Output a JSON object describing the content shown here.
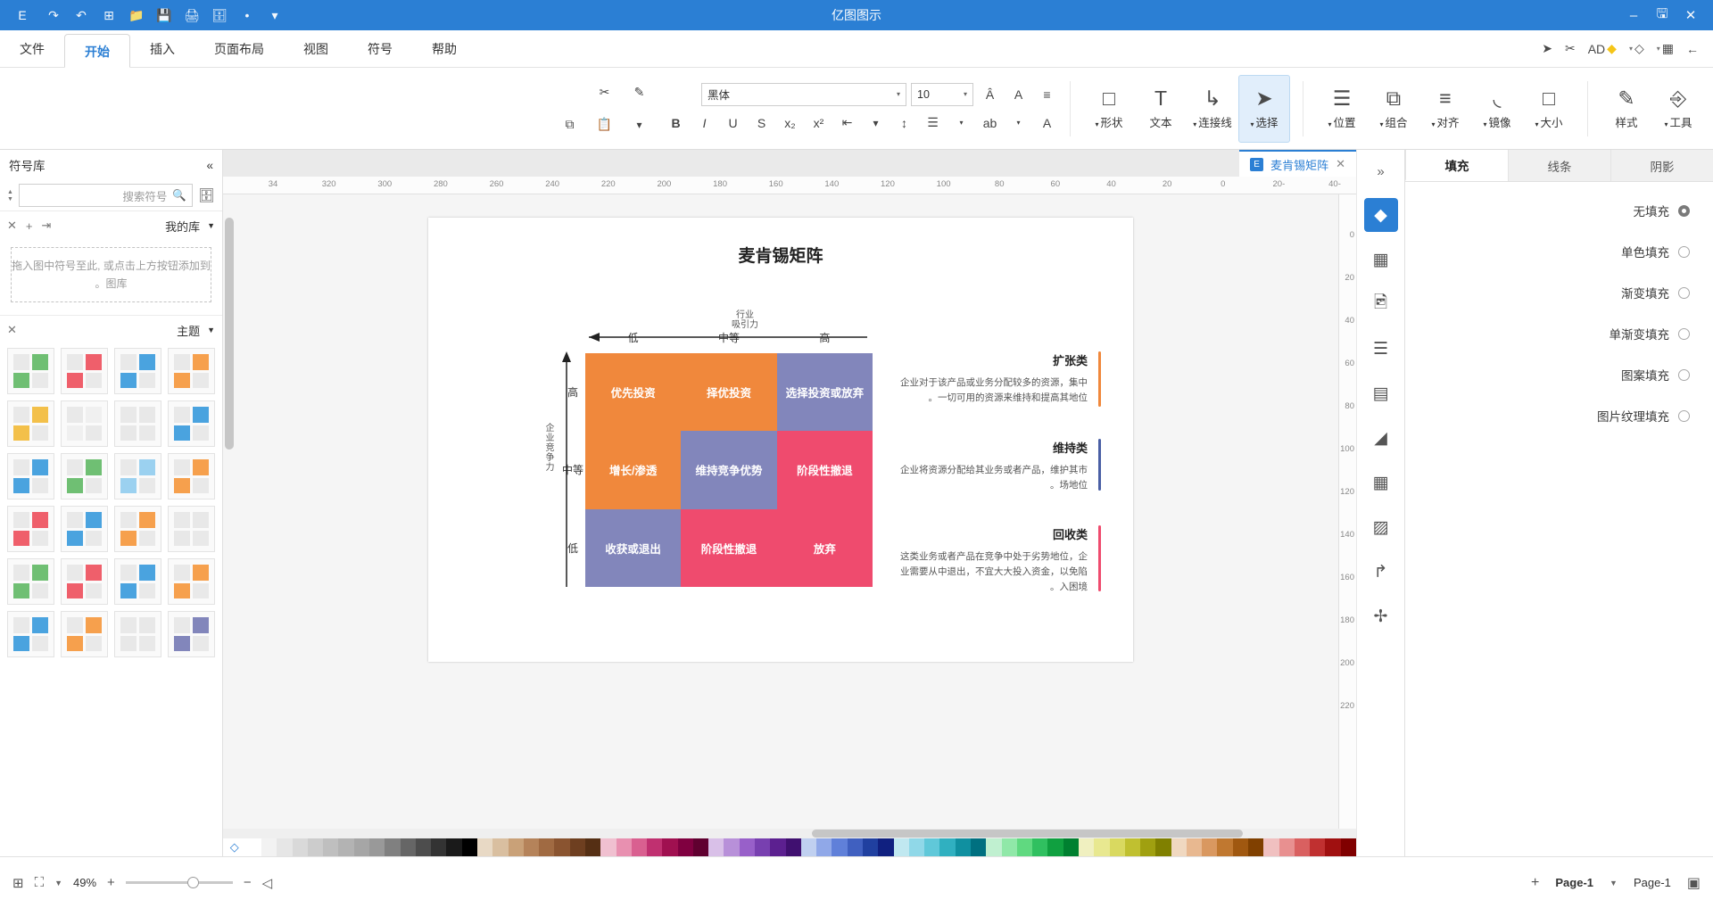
{
  "titlebar": {
    "title": "亿图图示",
    "left_icons": [
      "close-icon",
      "save-icon",
      "minimize-icon"
    ],
    "right_icons": [
      "chevron-down-icon",
      "grid-icon",
      "window-icon",
      "save-icon",
      "folder-icon",
      "new-icon",
      "undo-icon",
      "redo-icon"
    ],
    "app_badge": "E"
  },
  "quick_access": [
    {
      "name": "back",
      "glyph": "←"
    },
    {
      "name": "apps",
      "glyph": "∷",
      "caret": "▾"
    },
    {
      "name": "page-shape",
      "glyph": "⬜",
      "caret": "▾"
    },
    {
      "name": "highlight",
      "glyph": "◆",
      "label": "AD"
    },
    {
      "name": "scissors",
      "glyph": "✂"
    },
    {
      "name": "pointer",
      "glyph": "➤"
    }
  ],
  "ribbon_tabs": [
    {
      "label": "文件",
      "active": false
    },
    {
      "label": "开始",
      "active": true
    },
    {
      "label": "插入",
      "active": false
    },
    {
      "label": "页面布局",
      "active": false
    },
    {
      "label": "视图",
      "active": false
    },
    {
      "label": "符号",
      "active": false
    },
    {
      "label": "帮助",
      "active": false
    }
  ],
  "ribbon": {
    "font_name": "黑体",
    "font_size": "10",
    "buttons": [
      {
        "name": "tools",
        "label": "工具",
        "glyph": "⌨",
        "caret": true,
        "selected": false
      },
      {
        "name": "style",
        "label": "样式",
        "glyph": "✎",
        "caret": false,
        "selected": false
      },
      {
        "name": "size",
        "label": "大小",
        "glyph": "□",
        "caret": true,
        "selected": false
      },
      {
        "name": "mirror",
        "label": "镜像",
        "glyph": "◧",
        "caret": true,
        "selected": false
      },
      {
        "name": "align",
        "label": "对齐",
        "glyph": "≡",
        "caret": true,
        "selected": false
      },
      {
        "name": "combine",
        "label": "组合",
        "glyph": "⧉",
        "caret": true,
        "selected": false
      },
      {
        "name": "arrange",
        "label": "位置",
        "glyph": "☰",
        "caret": true,
        "selected": false
      },
      {
        "name": "select",
        "label": "选择",
        "glyph": "➤",
        "caret": true,
        "selected": true
      },
      {
        "name": "connector",
        "label": "连接线",
        "glyph": "⤴",
        "caret": true,
        "selected": false
      },
      {
        "name": "text",
        "label": "文本",
        "glyph": "T",
        "caret": false,
        "selected": false
      },
      {
        "name": "shape",
        "label": "形状",
        "glyph": "▭",
        "caret": true,
        "selected": false
      }
    ],
    "format_icons_row1": [
      "≡",
      "A",
      "Â"
    ],
    "format_icons_row2": [
      "A",
      "ab",
      "☰",
      "↕",
      "⤓",
      "x₂",
      "x²",
      "S",
      "U",
      "I",
      "B"
    ],
    "right_icons": [
      "✎",
      "✂",
      "⎘",
      "⧉"
    ]
  },
  "format_panel": {
    "tabs": [
      {
        "label": "填充",
        "active": true
      },
      {
        "label": "线条",
        "active": false
      },
      {
        "label": "阴影",
        "active": false
      }
    ],
    "options": [
      {
        "label": "无填充",
        "selected": true
      },
      {
        "label": "单色填充",
        "selected": false
      },
      {
        "label": "渐变填充",
        "selected": false
      },
      {
        "label": "单渐变填充",
        "selected": false
      },
      {
        "label": "图案填充",
        "selected": false
      },
      {
        "label": "图片纹理填充",
        "selected": false
      }
    ]
  },
  "left_rail": {
    "collapse_icon": "«",
    "items": [
      {
        "name": "fill-tool",
        "glyph": "◆",
        "active": true
      },
      {
        "name": "grid-tool",
        "glyph": "▦",
        "active": false
      },
      {
        "name": "image-tool",
        "glyph": "Ὓc",
        "active": false
      },
      {
        "name": "layers-tool",
        "glyph": "≣",
        "active": false
      },
      {
        "name": "container-tool",
        "glyph": "▤",
        "active": false
      },
      {
        "name": "chart-tool",
        "glyph": "◢",
        "active": false
      },
      {
        "name": "table-tool",
        "glyph": "⊞",
        "active": false
      },
      {
        "name": "crop-tool",
        "glyph": "⛶",
        "active": false
      },
      {
        "name": "flow-tool",
        "glyph": "↱",
        "active": false
      },
      {
        "name": "node-tool",
        "glyph": "⬚",
        "active": false
      }
    ]
  },
  "doc_tab": {
    "title": "麦肯锡矩阵",
    "close": "✕"
  },
  "rulers": {
    "h_ticks": [
      "-40",
      "-20",
      "0",
      "20",
      "40",
      "60",
      "80",
      "100",
      "120",
      "140",
      "160",
      "180",
      "200",
      "220",
      "240",
      "260",
      "280",
      "300",
      "320",
      "34"
    ],
    "v_ticks": [
      "0",
      "20",
      "40",
      "60",
      "80",
      "100",
      "120",
      "140",
      "160",
      "180",
      "200",
      "220"
    ]
  },
  "diagram": {
    "title": "麦肯锡矩阵",
    "x_axis_label": "行业\n吸引力",
    "y_axis_label": "企业竞争力",
    "col_headers": [
      "高",
      "中等",
      "低"
    ],
    "row_headers": [
      "高",
      "中等",
      "低"
    ],
    "cells": [
      {
        "text": "优先投资",
        "color": "#f0883c"
      },
      {
        "text": "择优投资",
        "color": "#f0883c"
      },
      {
        "text": "选择投资或放弃",
        "color": "#8286bb"
      },
      {
        "text": "增长/渗透",
        "color": "#f0883c"
      },
      {
        "text": "维持竞争优势",
        "color": "#8286bb"
      },
      {
        "text": "阶段性撤退",
        "color": "#ef4b6e"
      },
      {
        "text": "收获或退出",
        "color": "#8286bb"
      },
      {
        "text": "阶段性撤退",
        "color": "#ef4b6e"
      },
      {
        "text": "放弃",
        "color": "#ef4b6e"
      }
    ],
    "legend": [
      {
        "title": "扩张类",
        "color": "#f0883c",
        "desc": "企业对于该产品或业务分配较多的资源，集中一切可用的资源来维持和提高其地位。"
      },
      {
        "title": "维持类",
        "color": "#4a5fa5",
        "desc": "企业将资源分配给其业务或者产品，维护其市场地位。"
      },
      {
        "title": "回收类",
        "color": "#ef4b6e",
        "desc": "这类业务或者产品在竞争中处于劣势地位，企业需要从中退出，不宜大大投入资金，以免陷入困境。"
      }
    ]
  },
  "right_panel": {
    "header": "符号库",
    "header_icons": [
      "»",
      "⬛"
    ],
    "search_placeholder": "搜索符号",
    "sections": [
      {
        "title": "我的库",
        "icons": [
          "✕",
          "+",
          "⬚"
        ],
        "dropzone": "拖入图中符号至此, 或点击上方按钮添加到图库。"
      },
      {
        "title": "主题",
        "icons": [
          "✕"
        ]
      }
    ],
    "thumbs": [
      [
        "#f6a04d",
        "#4aa3df",
        "#ef5f6b",
        "#6fbf73"
      ],
      [
        "#4aa3df",
        "#e8e8e8",
        "#f0f0f0",
        "#f3c04a"
      ],
      [
        "#f6a04d",
        "#9bd1f0",
        "#6fbf73",
        "#4aa3df"
      ],
      [
        "#e8e8e8",
        "#f6a04d",
        "#4aa3df",
        "#ef5f6b"
      ],
      [
        "#f6a04d",
        "#4aa3df",
        "#ef5f6b",
        "#6fbf73"
      ],
      [
        "#8286bb",
        "#e8e8e8",
        "#f6a04d",
        "#4aa3df"
      ]
    ]
  },
  "status_bar": {
    "page_label": "Page-1",
    "page_tab": "Page-1",
    "add_page": "+",
    "dropdown": "▾",
    "zoom_percent": "49%",
    "zoom_out": "−",
    "zoom_in": "+",
    "icons": [
      "fit-page-icon",
      "fullscreen-icon",
      "presentation-icon",
      "layout-icon"
    ]
  },
  "palette_colors": [
    "#ffffff",
    "#f2f2f2",
    "#e6e6e6",
    "#d9d9d9",
    "#cccccc",
    "#bfbfbf",
    "#b3b3b3",
    "#a6a6a6",
    "#999999",
    "#808080",
    "#666666",
    "#4d4d4d",
    "#333333",
    "#1a1a1a",
    "#000000",
    "#e8d9c5",
    "#d9bfa0",
    "#c9a178",
    "#b5835a",
    "#a06a42",
    "#8a5430",
    "#6e3f20",
    "#552f14",
    "#f0c0d0",
    "#e890b0",
    "#d96090",
    "#c03070",
    "#a01050",
    "#800040",
    "#600030",
    "#d9c0e8",
    "#b890d9",
    "#9860c9",
    "#7840b0",
    "#5c2090",
    "#401070",
    "#c0d0f0",
    "#90a8e8",
    "#6080d9",
    "#4060c0",
    "#2040a0",
    "#102080",
    "#c0e8f0",
    "#90d8e8",
    "#60c8d9",
    "#30b0c0",
    "#1090a0",
    "#007080",
    "#c0f0d0",
    "#90e8a8",
    "#60d980",
    "#30c060",
    "#10a040",
    "#008030",
    "#f0f0c0",
    "#e8e890",
    "#d9d960",
    "#c0c030",
    "#a0a010",
    "#808000",
    "#f0d8c0",
    "#e8b890",
    "#d99860",
    "#c07830",
    "#a05810",
    "#804000",
    "#f0c0c0",
    "#e89090",
    "#d96060",
    "#c03030",
    "#a01010",
    "#800000"
  ]
}
